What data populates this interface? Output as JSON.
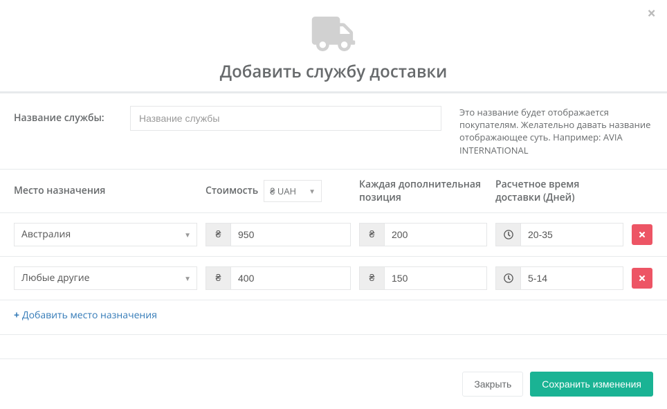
{
  "modal": {
    "title": "Добавить службу доставки"
  },
  "service_name": {
    "label": "Название службы:",
    "placeholder": "Название службы",
    "value": "",
    "hint": "Это название будет отображается покупателям. Желательно давать название отображающее суть. Например: AVIA INTERNATIONAL"
  },
  "table": {
    "headers": {
      "destination": "Место назначения",
      "cost": "Стоимость",
      "additional": "Каждая дополнительная позиция",
      "days": "Расчетное время доставки (Дней)"
    },
    "currency": "₴ UAH",
    "rows": [
      {
        "destination": "Австралия",
        "cost": "950",
        "additional": "200",
        "days": "20-35"
      },
      {
        "destination": "Любые другие",
        "cost": "400",
        "additional": "150",
        "days": "5-14"
      }
    ],
    "add_link": "Добавить место назначения"
  },
  "footer": {
    "close": "Закрыть",
    "save": "Сохранить изменения"
  }
}
